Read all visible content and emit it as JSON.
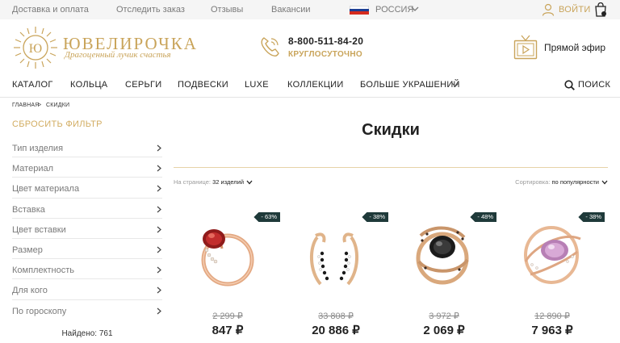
{
  "topbar": {
    "links": [
      "Доставка и оплата",
      "Отследить заказ",
      "Отзывы",
      "Вакансии"
    ],
    "country": "РОССИЯ",
    "login": "ВОЙТИ"
  },
  "header": {
    "brand": "ЮВЕЛИРОЧКА",
    "slogan": "Драгоценный лучик счастья",
    "logo_letters": "Ю",
    "phone": "8-800-511-84-20",
    "phone_sub": "КРУГЛОСУТОЧНО",
    "live": "Прямой эфир"
  },
  "nav": {
    "items": [
      "КАТАЛОГ",
      "КОЛЬЦА",
      "СЕРЬГИ",
      "ПОДВЕСКИ",
      "LUXE",
      "КОЛЛЕКЦИИ",
      "БОЛЬШЕ УКРАШЕНИЙ"
    ],
    "search": "ПОИСК"
  },
  "breadcrumb": {
    "home": "ГЛАВНАЯ",
    "separator": ">",
    "current": "СКИДКИ"
  },
  "sidebar": {
    "reset": "СБРОСИТЬ ФИЛЬТР",
    "filters": [
      "Тип изделия",
      "Материал",
      "Цвет материала",
      "Вставка",
      "Цвет вставки",
      "Размер",
      "Комплектность",
      "Для кого",
      "По гороскопу"
    ],
    "found": "Найдено: 761"
  },
  "main": {
    "title": "Скидки",
    "per_page_label": "На странице:",
    "per_page_value": "32 изделий",
    "sort_label": "Сортировка:",
    "sort_value": "по популярности"
  },
  "products": [
    {
      "badge": "- 63%",
      "old_price": "2 299 ₽",
      "price": "847 ₽",
      "image": "ring-garnet"
    },
    {
      "badge": "- 38%",
      "old_price": "33 808 ₽",
      "price": "20 886 ₽",
      "image": "earrings-black-stones"
    },
    {
      "badge": "- 48%",
      "old_price": "3 972 ₽",
      "price": "2 069 ₽",
      "image": "ring-black-stone"
    },
    {
      "badge": "- 38%",
      "old_price": "12 890 ₽",
      "price": "7 963 ₽",
      "image": "ring-amethyst"
    }
  ],
  "colors": {
    "gold": "#c9a45a",
    "badge": "#1f3a3a",
    "flag": [
      "#ffffff",
      "#1c3f94",
      "#d52b1e"
    ]
  }
}
